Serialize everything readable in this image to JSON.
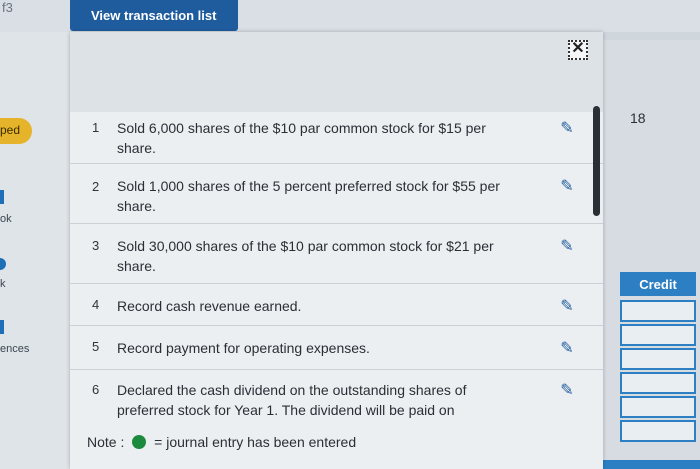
{
  "background": {
    "corner_label": "f3",
    "pill_label": "ped",
    "side_labels": [
      "ok",
      "k",
      "ences"
    ],
    "right_value": "18",
    "credit_header": "Credit"
  },
  "header": {
    "view_button_label": "View transaction list"
  },
  "modal": {
    "close_label": "✕",
    "transactions": [
      {
        "num": "1",
        "text": "Sold 6,000 shares of the $10 par common stock for $15 per share."
      },
      {
        "num": "2",
        "text": "Sold 1,000 shares of the 5 percent preferred stock for $55 per share."
      },
      {
        "num": "3",
        "text": "Sold 30,000 shares of the $10 par common stock for $21 per share."
      },
      {
        "num": "4",
        "text": "Record cash revenue earned."
      },
      {
        "num": "5",
        "text": "Record payment for operating expenses."
      },
      {
        "num": "6",
        "text": "Declared the cash dividend on the outstanding shares of preferred stock for Year 1. The dividend will be paid on"
      }
    ],
    "edit_icon": "pencil-icon",
    "note_prefix": "Note :",
    "note_suffix": "= journal entry has been entered",
    "colors": {
      "accent": "#1f5c9e",
      "entered_dot": "#1c8a3d"
    }
  }
}
